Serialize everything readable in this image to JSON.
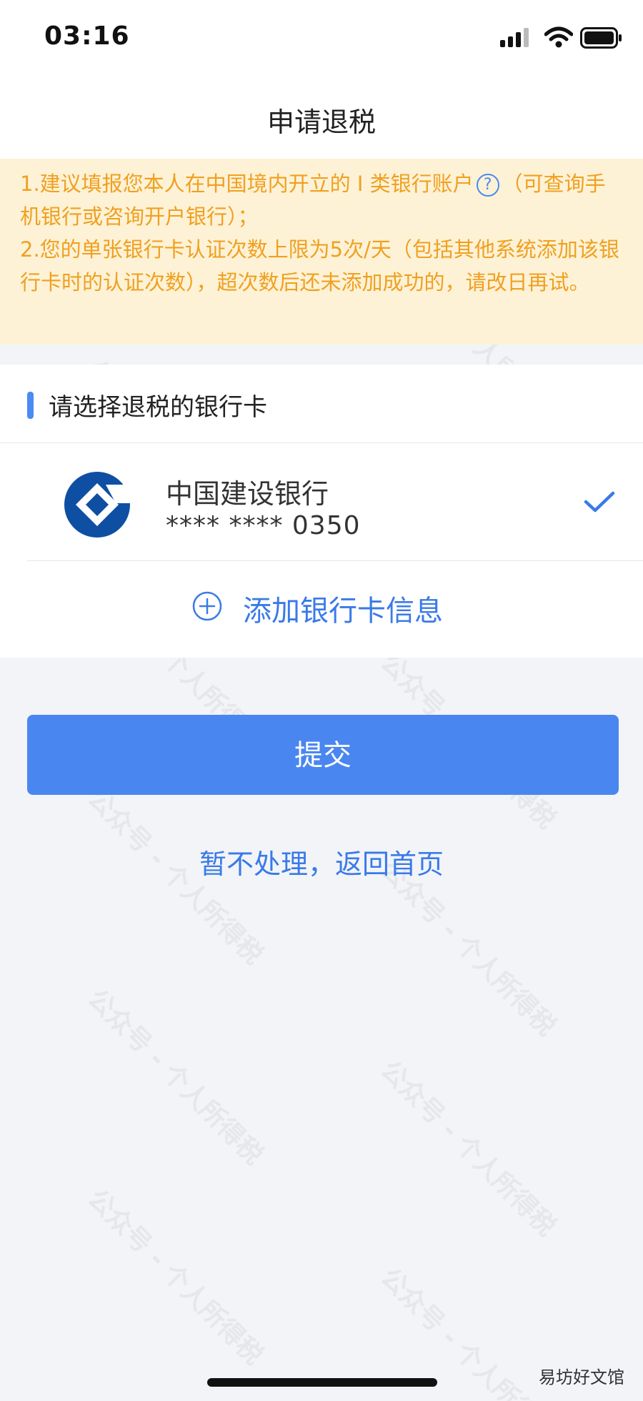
{
  "status_bar": {
    "time": "03:16"
  },
  "header": {
    "title": "申请退税"
  },
  "notice": {
    "line1_before": "1.建议填报您本人在中国境内开立的 I 类银行账户",
    "line1_after": "（可查询手机银行或咨询开户银行）；",
    "line2": "2.您的单张银行卡认证次数上限为5次/天（包括其他系统添加该银行卡时的认证次数），超次数后还未添加成功的，请改日再试。",
    "help_symbol": "?"
  },
  "card_section": {
    "title": "请选择退税的银行卡",
    "cards": [
      {
        "bank_name": "中国建设银行",
        "card_number": "**** **** 0350",
        "selected": true
      }
    ],
    "add_label": "添加银行卡信息"
  },
  "actions": {
    "submit_label": "提交",
    "back_label": "暂不处理，返回首页"
  },
  "watermark": {
    "text": "公众号 - 个人所得税"
  },
  "corner_mark": "易坊好文馆",
  "colors": {
    "accent": "#4a86f0",
    "link": "#3a7ae8",
    "notice_bg": "#fdf2d6",
    "notice_text": "#f0a020",
    "page_bg": "#f2f4f8"
  }
}
